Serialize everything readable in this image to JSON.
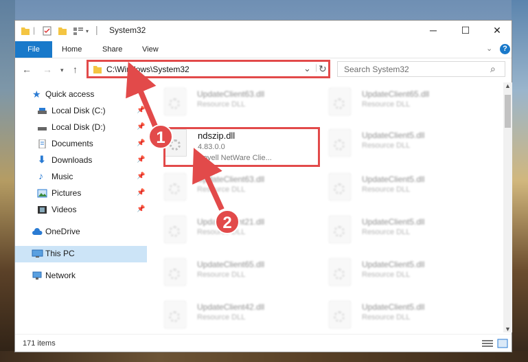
{
  "window": {
    "title": "System32",
    "controls": {
      "minimize": "─",
      "maximize": "☐",
      "close": "✕"
    }
  },
  "ribbon": {
    "tabs": [
      {
        "label": "File"
      },
      {
        "label": "Home"
      },
      {
        "label": "Share"
      },
      {
        "label": "View"
      }
    ],
    "help": "?"
  },
  "address": {
    "path": "C:\\Windows\\System32",
    "refresh": "↻",
    "dropdown": "⌄"
  },
  "search": {
    "placeholder": "Search System32",
    "icon": "⌕"
  },
  "sidebar": {
    "items": [
      {
        "label": "Quick access"
      },
      {
        "label": "Local Disk (C:)"
      },
      {
        "label": "Local Disk (D:)"
      },
      {
        "label": "Documents"
      },
      {
        "label": "Downloads"
      },
      {
        "label": "Music"
      },
      {
        "label": "Pictures"
      },
      {
        "label": "Videos"
      },
      {
        "label": "OneDrive"
      },
      {
        "label": "This PC"
      },
      {
        "label": "Network"
      }
    ]
  },
  "files": {
    "left": [
      {
        "name": "UpdateClient63.dll",
        "desc": "Resource DLL"
      },
      {
        "name": "UpdateClient63.dll",
        "desc": "Resource DLL"
      },
      {
        "name": "UpdateClient21.dll",
        "desc": "Resource DLL"
      },
      {
        "name": "UpdateClient65.dll",
        "desc": "Resource DLL"
      },
      {
        "name": "UpdateClient42.dll",
        "desc": "Resource DLL"
      }
    ],
    "right": [
      {
        "name": "UpdateClient65.dll",
        "desc": "Resource DLL"
      },
      {
        "name": "UpdateClient5.dll",
        "desc": "Resource DLL"
      },
      {
        "name": "UpdateClient5.dll",
        "desc": "Resource DLL"
      },
      {
        "name": "UpdateClient5.dll",
        "desc": "Resource DLL"
      },
      {
        "name": "UpdateClient5.dll",
        "desc": "Resource DLL"
      },
      {
        "name": "UpdateClient5.dll",
        "desc": "Resource DLL"
      }
    ],
    "highlighted": {
      "name": "ndszip.dll",
      "version": "4.83.0.0",
      "desc": "Novell NetWare Clie..."
    }
  },
  "status": {
    "count": "171 items"
  },
  "annotations": {
    "step1": "1",
    "step2": "2"
  },
  "colors": {
    "accent": "#1979ca",
    "annotation": "#e24a4a",
    "selected": "#cce4f7"
  }
}
